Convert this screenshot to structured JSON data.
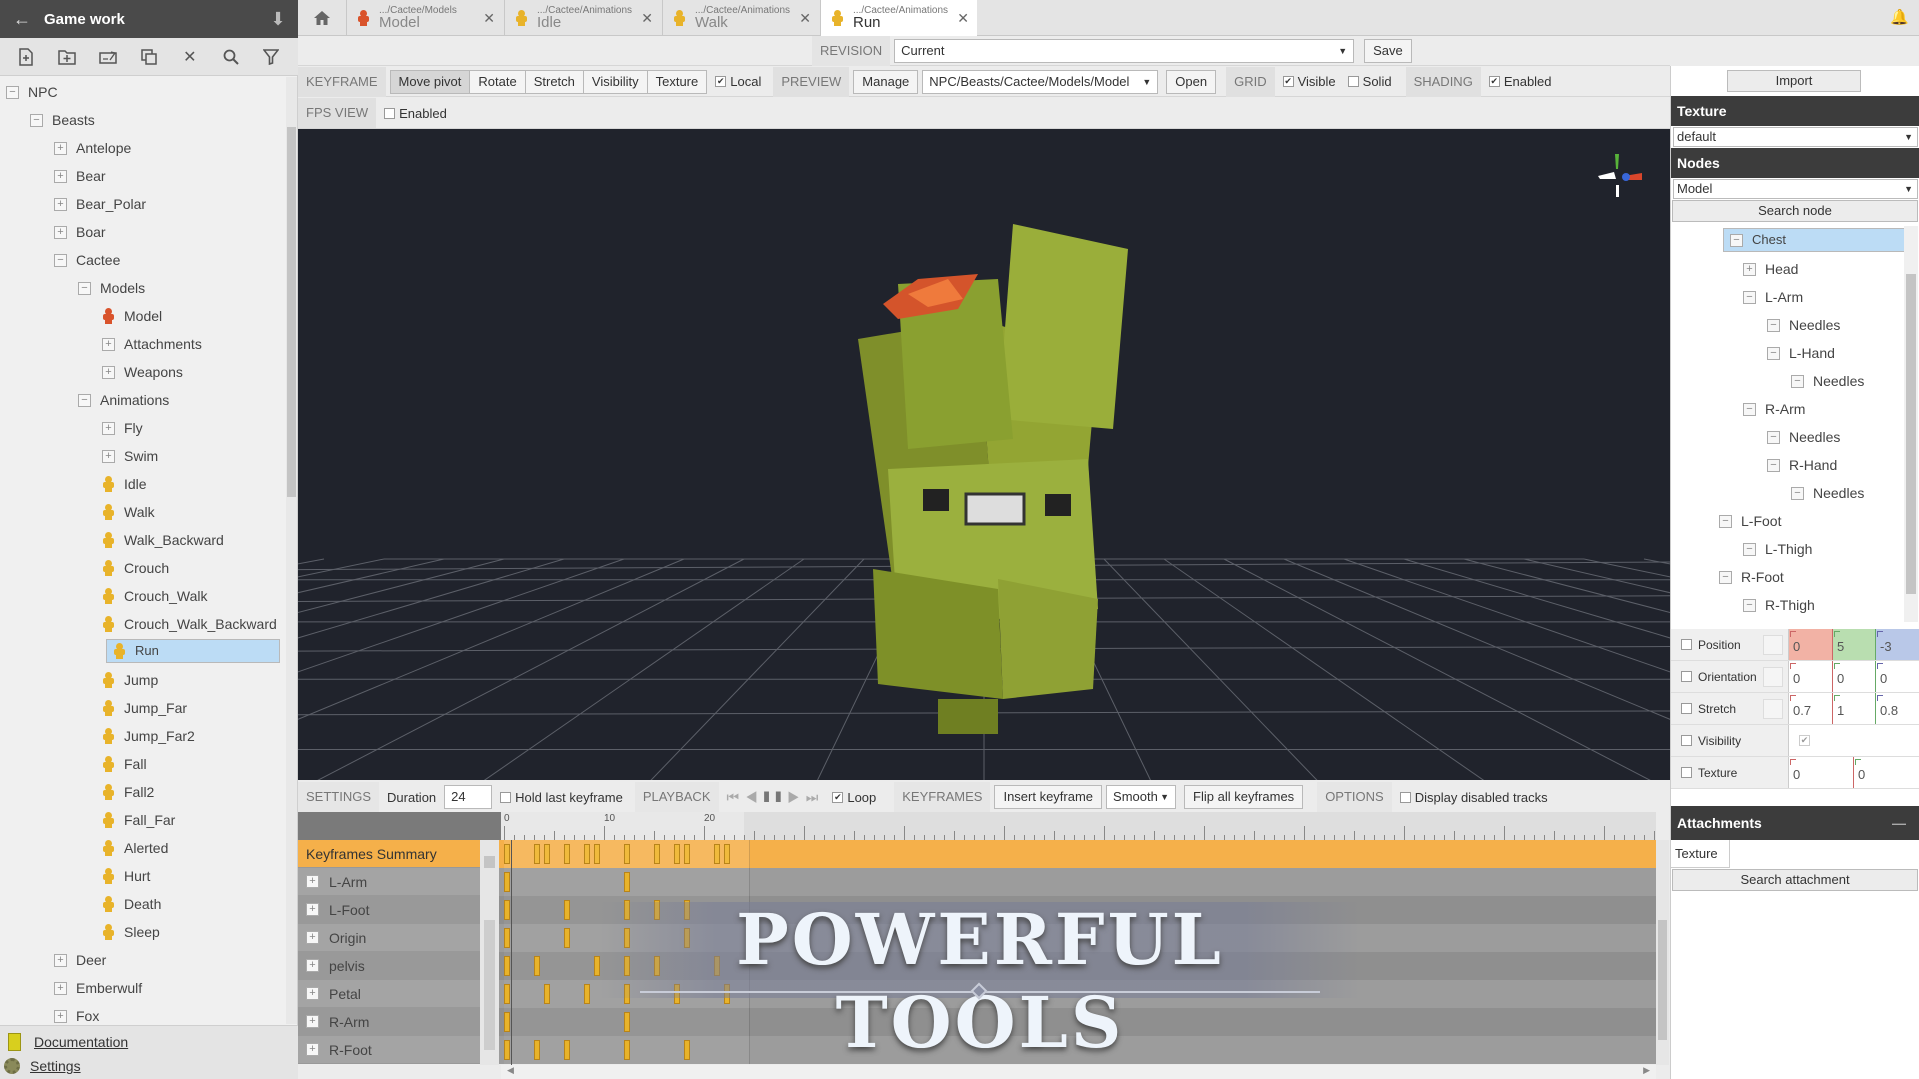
{
  "sidebar": {
    "title": "Game work",
    "tools": [
      "new-file",
      "new-folder",
      "rename",
      "duplicate",
      "delete",
      "search",
      "filter"
    ],
    "tree": [
      {
        "label": "NPC",
        "depth": 0,
        "type": "minus"
      },
      {
        "label": "Beasts",
        "depth": 1,
        "type": "minus"
      },
      {
        "label": "Antelope",
        "depth": 2,
        "type": "plus"
      },
      {
        "label": "Bear",
        "depth": 2,
        "type": "plus"
      },
      {
        "label": "Bear_Polar",
        "depth": 2,
        "type": "plus"
      },
      {
        "label": "Boar",
        "depth": 2,
        "type": "plus"
      },
      {
        "label": "Cactee",
        "depth": 2,
        "type": "minus"
      },
      {
        "label": "Models",
        "depth": 3,
        "type": "minus"
      },
      {
        "label": "Model",
        "depth": 4,
        "type": "model"
      },
      {
        "label": "Attachments",
        "depth": 4,
        "type": "plus"
      },
      {
        "label": "Weapons",
        "depth": 4,
        "type": "plus"
      },
      {
        "label": "Animations",
        "depth": 3,
        "type": "minus"
      },
      {
        "label": "Fly",
        "depth": 4,
        "type": "plus"
      },
      {
        "label": "Swim",
        "depth": 4,
        "type": "plus"
      },
      {
        "label": "Idle",
        "depth": 4,
        "type": "anim"
      },
      {
        "label": "Walk",
        "depth": 4,
        "type": "anim"
      },
      {
        "label": "Walk_Backward",
        "depth": 4,
        "type": "anim"
      },
      {
        "label": "Crouch",
        "depth": 4,
        "type": "anim"
      },
      {
        "label": "Crouch_Walk",
        "depth": 4,
        "type": "anim"
      },
      {
        "label": "Crouch_Walk_Backward",
        "depth": 4,
        "type": "anim"
      },
      {
        "label": "Run",
        "depth": 4,
        "type": "anim",
        "selected": true
      },
      {
        "label": "Jump",
        "depth": 4,
        "type": "anim"
      },
      {
        "label": "Jump_Far",
        "depth": 4,
        "type": "anim"
      },
      {
        "label": "Jump_Far2",
        "depth": 4,
        "type": "anim"
      },
      {
        "label": "Fall",
        "depth": 4,
        "type": "anim"
      },
      {
        "label": "Fall2",
        "depth": 4,
        "type": "anim"
      },
      {
        "label": "Fall_Far",
        "depth": 4,
        "type": "anim"
      },
      {
        "label": "Alerted",
        "depth": 4,
        "type": "anim"
      },
      {
        "label": "Hurt",
        "depth": 4,
        "type": "anim"
      },
      {
        "label": "Death",
        "depth": 4,
        "type": "anim"
      },
      {
        "label": "Sleep",
        "depth": 4,
        "type": "anim"
      },
      {
        "label": "Deer",
        "depth": 2,
        "type": "plus"
      },
      {
        "label": "Emberwulf",
        "depth": 2,
        "type": "plus"
      },
      {
        "label": "Fox",
        "depth": 2,
        "type": "plus"
      }
    ],
    "footer": {
      "documentation": "Documentation",
      "settings": "Settings"
    }
  },
  "tabs": [
    {
      "path": ".../Cactee/Models",
      "name": "Model",
      "icon": "model",
      "active": false
    },
    {
      "path": ".../Cactee/Animations",
      "name": "Idle",
      "icon": "anim",
      "active": false
    },
    {
      "path": ".../Cactee/Animations",
      "name": "Walk",
      "icon": "anim",
      "active": false
    },
    {
      "path": ".../Cactee/Animations",
      "name": "Run",
      "icon": "anim",
      "active": true
    }
  ],
  "revision": {
    "label": "REVISION",
    "value": "Current",
    "save": "Save"
  },
  "keyframe": {
    "label": "KEYFRAME",
    "modes": [
      "Move pivot",
      "Rotate",
      "Stretch",
      "Visibility",
      "Texture"
    ],
    "active_mode": "Move pivot",
    "local_label": "Local",
    "local_checked": true
  },
  "preview": {
    "label": "PREVIEW",
    "manage": "Manage",
    "model": "NPC/Beasts/Cactee/Models/Model",
    "open": "Open"
  },
  "grid": {
    "label": "GRID",
    "visible_label": "Visible",
    "visible": true,
    "solid_label": "Solid",
    "solid": false
  },
  "shading": {
    "label": "SHADING",
    "enabled_label": "Enabled",
    "enabled": true
  },
  "fps": {
    "label": "FPS VIEW",
    "enabled_label": "Enabled",
    "enabled": false
  },
  "right": {
    "import": "Import",
    "texture_title": "Texture",
    "texture_value": "default",
    "nodes_title": "Nodes",
    "nodes_value": "Model",
    "search_node": "Search node",
    "nodes": [
      {
        "label": "Chest",
        "depth": 0,
        "type": "minus",
        "selected": true
      },
      {
        "label": "Head",
        "depth": 1,
        "type": "plus"
      },
      {
        "label": "L-Arm",
        "depth": 1,
        "type": "minus"
      },
      {
        "label": "Needles",
        "depth": 2,
        "type": "minus"
      },
      {
        "label": "L-Hand",
        "depth": 2,
        "type": "minus"
      },
      {
        "label": "Needles",
        "depth": 3,
        "type": "minus"
      },
      {
        "label": "R-Arm",
        "depth": 1,
        "type": "minus"
      },
      {
        "label": "Needles",
        "depth": 2,
        "type": "minus"
      },
      {
        "label": "R-Hand",
        "depth": 2,
        "type": "minus"
      },
      {
        "label": "Needles",
        "depth": 3,
        "type": "minus"
      },
      {
        "label": "L-Foot",
        "depth": 0,
        "type": "minus"
      },
      {
        "label": "L-Thigh",
        "depth": 1,
        "type": "minus"
      },
      {
        "label": "R-Foot",
        "depth": 0,
        "type": "minus"
      },
      {
        "label": "R-Thigh",
        "depth": 1,
        "type": "minus"
      }
    ],
    "properties": {
      "position": {
        "label": "Position",
        "values": [
          "0",
          "5",
          "-3"
        ]
      },
      "orientation": {
        "label": "Orientation",
        "values": [
          "0",
          "0",
          "0"
        ]
      },
      "stretch": {
        "label": "Stretch",
        "values": [
          "0.7",
          "1",
          "0.8"
        ]
      },
      "visibility": {
        "label": "Visibility",
        "value": true
      },
      "texture": {
        "label": "Texture",
        "values": [
          "0",
          "0"
        ]
      }
    },
    "attachments_title": "Attachments",
    "attachments_texture_label": "Texture",
    "search_attachment": "Search attachment"
  },
  "timeline": {
    "settings_label": "SETTINGS",
    "duration_label": "Duration",
    "duration": "24",
    "hold_label": "Hold last keyframe",
    "hold": false,
    "playback_label": "PLAYBACK",
    "loop_label": "Loop",
    "loop": true,
    "keyframes_label": "KEYFRAMES",
    "insert": "Insert keyframe",
    "interp": "Smooth",
    "flip": "Flip all keyframes",
    "options_label": "OPTIONS",
    "disabled_label": "Display disabled tracks",
    "disabled": false,
    "ruler_labels": [
      "0",
      "10",
      "20"
    ],
    "summary_label": "Keyframes Summary",
    "summary_frames": [
      0,
      3,
      4,
      6,
      8,
      9,
      12,
      15,
      17,
      18,
      21,
      22
    ],
    "tracks": [
      {
        "name": "L-Arm",
        "frames": [
          0,
          12
        ]
      },
      {
        "name": "L-Foot",
        "frames": [
          0,
          6,
          12,
          15,
          18
        ]
      },
      {
        "name": "Origin",
        "frames": [
          0,
          6,
          12,
          18
        ]
      },
      {
        "name": "pelvis",
        "frames": [
          0,
          3,
          9,
          12,
          15,
          21
        ]
      },
      {
        "name": "Petal",
        "frames": [
          0,
          4,
          8,
          12,
          17,
          22
        ]
      },
      {
        "name": "R-Arm",
        "frames": [
          0,
          12
        ]
      },
      {
        "name": "R-Foot",
        "frames": [
          0,
          3,
          6,
          12,
          18
        ]
      }
    ]
  },
  "overlay": {
    "title": "POWERFUL TOOLS"
  },
  "colors": {
    "accent": "#f5b04a",
    "keyframe": "#e8b32a",
    "selection": "#bcdcf5",
    "header": "#4a4a4a",
    "x": "#f2b2a5",
    "y": "#b9deb0",
    "z": "#b9c8e8"
  }
}
